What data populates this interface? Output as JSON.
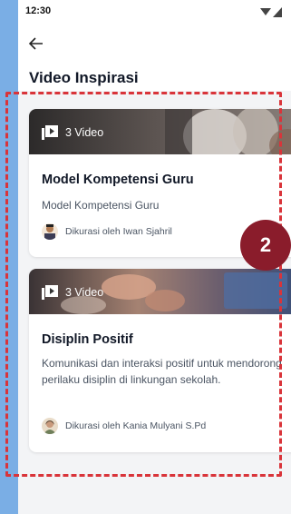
{
  "status_bar": {
    "time": "12:30"
  },
  "header": {
    "title": "Video Inspirasi"
  },
  "cards": [
    {
      "video_count": "3 Video",
      "title": "Model Kompetensi Guru",
      "description": "Model Kompetensi Guru",
      "curator": "Dikurasi oleh Iwan Sjahril"
    },
    {
      "video_count": "3 Video",
      "title": "Disiplin Positif",
      "description": "Komunikasi dan interaksi positif untuk mendorong perilaku disiplin di linkungan sekolah.",
      "curator": "Dikurasi oleh Kania Mulyani S.Pd"
    }
  ],
  "annotation": {
    "badge_number": "2",
    "highlight_color": "#d9343a",
    "badge_color": "#8a1c2b"
  }
}
